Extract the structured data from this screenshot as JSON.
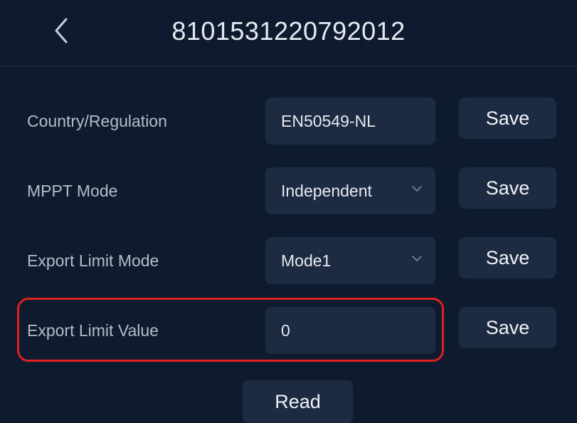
{
  "header": {
    "title": "8101531220792012",
    "back_icon": "chevron-left-icon"
  },
  "settings": [
    {
      "label": "Country/Regulation",
      "value": "EN50549-NL",
      "dropdown": false,
      "save_label": "Save"
    },
    {
      "label": "MPPT Mode",
      "value": "Independent",
      "dropdown": true,
      "save_label": "Save"
    },
    {
      "label": "Export Limit Mode",
      "value": "Mode1",
      "dropdown": true,
      "save_label": "Save"
    },
    {
      "label": "Export Limit Value",
      "value": "0",
      "dropdown": false,
      "save_label": "Save",
      "highlighted": true
    }
  ],
  "footer": {
    "read_label": "Read"
  },
  "colors": {
    "background": "#0e1a2e",
    "field": "#1c2a42",
    "highlight": "#e02020"
  }
}
